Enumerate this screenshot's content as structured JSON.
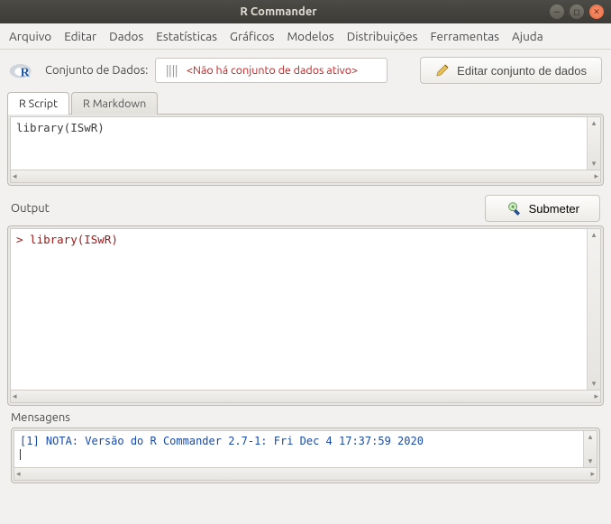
{
  "window": {
    "title": "R Commander"
  },
  "menu": {
    "arquivo": "Arquivo",
    "editar": "Editar",
    "dados": "Dados",
    "estatisticas": "Estatísticas",
    "graficos": "Gráficos",
    "modelos": "Modelos",
    "distribuicoes": "Distribuições",
    "ferramentas": "Ferramentas",
    "ajuda": "Ajuda"
  },
  "toolbar": {
    "dataset_label": "Conjunto de Dados:",
    "dataset_status": "<Não há conjunto de dados ativo>",
    "edit_button": "Editar conjunto de dados"
  },
  "tabs": {
    "script": "R Script",
    "markdown": "R Markdown"
  },
  "script": {
    "content": "library(ISwR)"
  },
  "output": {
    "label": "Output",
    "submit": "Submeter",
    "content": "> library(ISwR)"
  },
  "messages": {
    "label": "Mensagens",
    "content": "[1] NOTA: Versão do R Commander 2.7-1: Fri Dec 4 17:37:59 2020"
  }
}
